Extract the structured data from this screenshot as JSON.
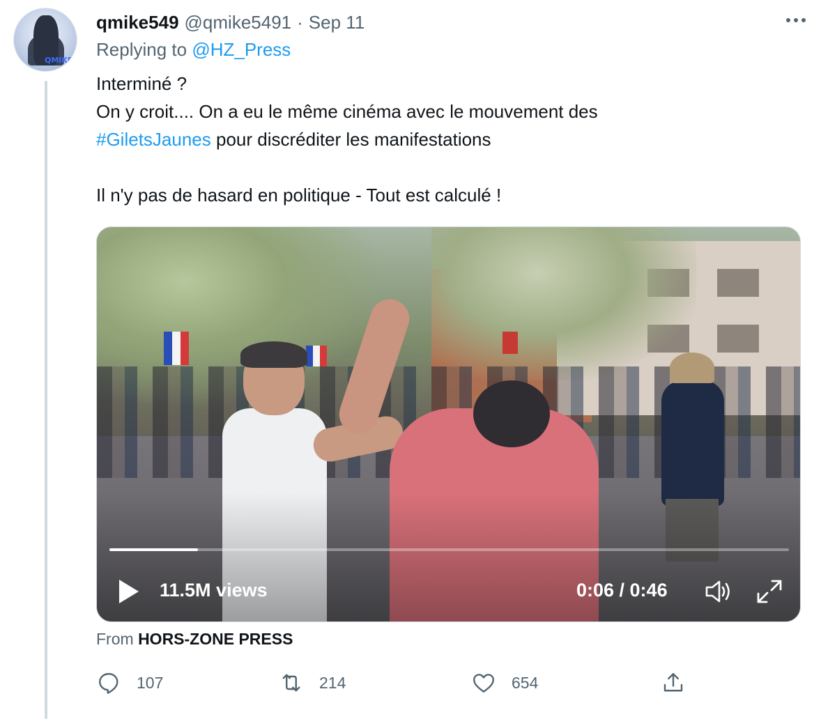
{
  "tweet": {
    "author_name": "qmike549",
    "author_handle": "@qmike5491",
    "separator": "·",
    "date": "Sep 11",
    "reply_prefix": "Replying to",
    "reply_to": "@HZ_Press",
    "lines": {
      "l1": "Interminé ?",
      "l2": "On y croit.... On a eu le même cinéma avec le  mouvement des",
      "l3_hashtag": "#GiletsJaunes",
      "l3_rest": " pour discréditer les manifestations",
      "l4": "Il n'y pas de hasard en politique - Tout est calculé !"
    },
    "avatar_text": "QMIKE"
  },
  "video": {
    "views": "11.5M views",
    "time": "0:06 / 0:46",
    "progress_fraction": 0.13,
    "icons": [
      "play-icon",
      "volume-icon",
      "fullscreen-icon"
    ]
  },
  "source": {
    "prefix": "From",
    "name": "HORS-ZONE PRESS"
  },
  "actions": {
    "replies": "107",
    "retweets": "214",
    "likes": "654",
    "icons": [
      "reply-icon",
      "retweet-icon",
      "like-icon",
      "share-icon"
    ]
  },
  "colors": {
    "link": "#1d9bf0",
    "secondary_text": "#536471",
    "primary_text": "#0f1419",
    "thread_line": "#cfd9de"
  }
}
